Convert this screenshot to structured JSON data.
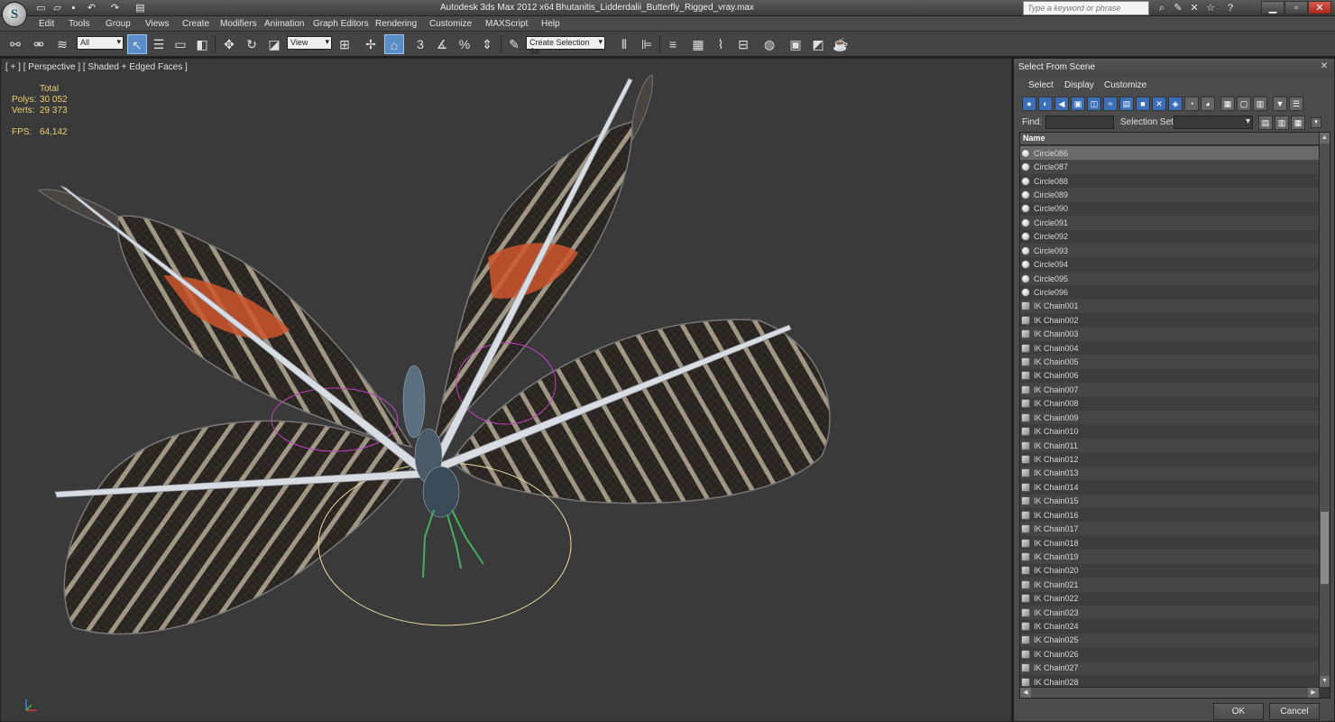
{
  "app": {
    "title": "Autodesk 3ds Max  2012 x64",
    "file": "Bhutanitis_Lidderdalii_Butterfly_Rigged_vray.max",
    "logo_letter": "S",
    "search_placeholder": "Type a keyword or phrase"
  },
  "menu": [
    "Edit",
    "Tools",
    "Group",
    "Views",
    "Create",
    "Modifiers",
    "Animation",
    "Graph Editors",
    "Rendering",
    "Customize",
    "MAXScript",
    "Help"
  ],
  "toolbar": {
    "filter_value": "All",
    "ref_coord_value": "View",
    "selection_set_placeholder": "Create Selection Se",
    "snap_3": "3",
    "percent": "%"
  },
  "viewport": {
    "label": "[ + ] [ Perspective ] [ Shaded + Edged Faces ]",
    "stats": {
      "total_label": "Total",
      "polys_label": "Polys:",
      "polys_value": "30 052",
      "verts_label": "Verts:",
      "verts_value": "29 373",
      "fps_label": "FPS:",
      "fps_value": "64,142"
    },
    "colors": {
      "background": "#3a3a3a",
      "wing_dark": "#2a2420",
      "wing_stripe": "#c9c0a8",
      "wing_orange": "#d2552a",
      "bone": "#d8dde4",
      "circle_magenta": "#c040c0",
      "circle_yellow": "#e8e0a0",
      "leg_green": "#40b060"
    }
  },
  "dialog": {
    "title": "Select From Scene",
    "close": "✕",
    "menu": [
      "Select",
      "Display",
      "Customize"
    ],
    "find_label": "Find:",
    "selection_set_label": "Selection Set:",
    "column_name": "Name",
    "items": [
      {
        "name": "Circle086",
        "type": "circle",
        "selected": true
      },
      {
        "name": "Circle087",
        "type": "circle"
      },
      {
        "name": "Circle088",
        "type": "circle"
      },
      {
        "name": "Circle089",
        "type": "circle"
      },
      {
        "name": "Circle090",
        "type": "circle"
      },
      {
        "name": "Circle091",
        "type": "circle"
      },
      {
        "name": "Circle092",
        "type": "circle"
      },
      {
        "name": "Circle093",
        "type": "circle"
      },
      {
        "name": "Circle094",
        "type": "circle"
      },
      {
        "name": "Circle095",
        "type": "circle"
      },
      {
        "name": "Circle096",
        "type": "circle"
      },
      {
        "name": "IK Chain001",
        "type": "ik"
      },
      {
        "name": "IK Chain002",
        "type": "ik"
      },
      {
        "name": "IK Chain003",
        "type": "ik"
      },
      {
        "name": "IK Chain004",
        "type": "ik"
      },
      {
        "name": "IK Chain005",
        "type": "ik"
      },
      {
        "name": "IK Chain006",
        "type": "ik"
      },
      {
        "name": "IK Chain007",
        "type": "ik"
      },
      {
        "name": "IK Chain008",
        "type": "ik"
      },
      {
        "name": "IK Chain009",
        "type": "ik"
      },
      {
        "name": "IK Chain010",
        "type": "ik"
      },
      {
        "name": "IK Chain011",
        "type": "ik"
      },
      {
        "name": "IK Chain012",
        "type": "ik"
      },
      {
        "name": "IK Chain013",
        "type": "ik"
      },
      {
        "name": "IK Chain014",
        "type": "ik"
      },
      {
        "name": "IK Chain015",
        "type": "ik"
      },
      {
        "name": "IK Chain016",
        "type": "ik"
      },
      {
        "name": "IK Chain017",
        "type": "ik"
      },
      {
        "name": "IK Chain018",
        "type": "ik"
      },
      {
        "name": "IK Chain019",
        "type": "ik"
      },
      {
        "name": "IK Chain020",
        "type": "ik"
      },
      {
        "name": "IK Chain021",
        "type": "ik"
      },
      {
        "name": "IK Chain022",
        "type": "ik"
      },
      {
        "name": "IK Chain023",
        "type": "ik"
      },
      {
        "name": "IK Chain024",
        "type": "ik"
      },
      {
        "name": "IK Chain025",
        "type": "ik"
      },
      {
        "name": "IK Chain026",
        "type": "ik"
      },
      {
        "name": "IK Chain027",
        "type": "ik"
      },
      {
        "name": "IK Chain028",
        "type": "ik"
      }
    ],
    "ok_label": "OK",
    "cancel_label": "Cancel"
  }
}
